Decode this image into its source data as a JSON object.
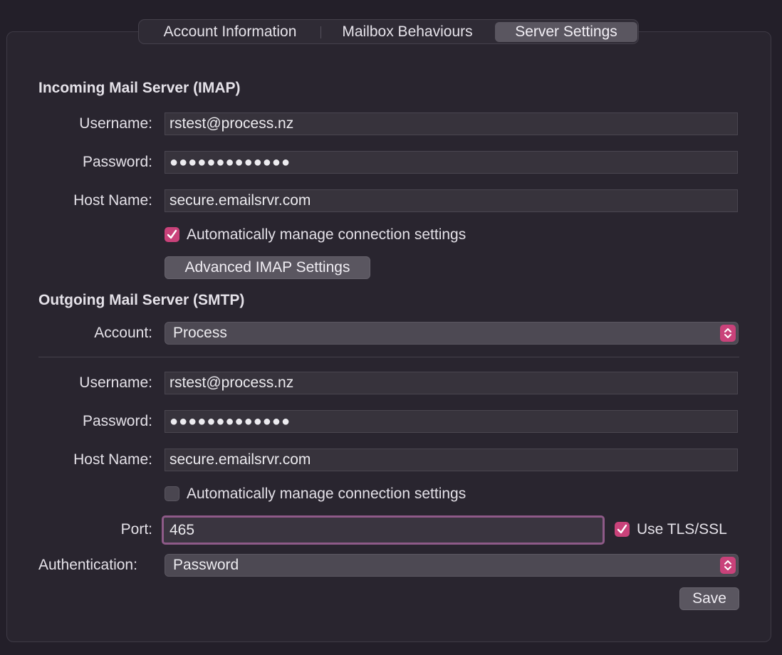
{
  "tabs": [
    {
      "label": "Account Information"
    },
    {
      "label": "Mailbox Behaviours"
    },
    {
      "label": "Server Settings"
    }
  ],
  "incoming": {
    "title": "Incoming Mail Server (IMAP)",
    "username_label": "Username:",
    "username_value": "rstest@process.nz",
    "password_label": "Password:",
    "password_value": "●●●●●●●●●●●●●",
    "hostname_label": "Host Name:",
    "hostname_value": "secure.emailsrvr.com",
    "auto_manage_label": "Automatically manage connection settings",
    "auto_manage_checked": true,
    "advanced_button": "Advanced IMAP Settings"
  },
  "outgoing": {
    "title": "Outgoing Mail Server (SMTP)",
    "account_label": "Account:",
    "account_value": "Process",
    "username_label": "Username:",
    "username_value": "rstest@process.nz",
    "password_label": "Password:",
    "password_value": "●●●●●●●●●●●●●",
    "hostname_label": "Host Name:",
    "hostname_value": "secure.emailsrvr.com",
    "auto_manage_label": "Automatically manage connection settings",
    "auto_manage_checked": false,
    "port_label": "Port:",
    "port_value": "465",
    "tls_label": "Use TLS/SSL",
    "tls_checked": true,
    "auth_label": "Authentication:",
    "auth_value": "Password",
    "save_button": "Save"
  },
  "colors": {
    "accent": "#c9427a",
    "focus_ring": "#8e5a88",
    "background": "#231f29"
  }
}
